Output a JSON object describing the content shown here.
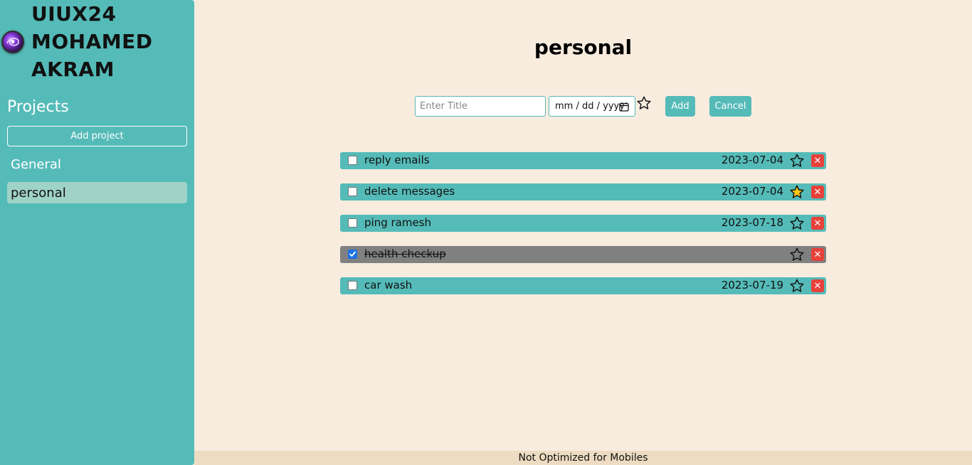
{
  "sidebar": {
    "brand": "UIUX24 MOHAMED AKRAM",
    "projects_heading": "Projects",
    "add_project_label": "Add project",
    "projects": [
      {
        "label": "General",
        "active": false
      },
      {
        "label": "personal",
        "active": true
      }
    ]
  },
  "main": {
    "title": "personal",
    "form": {
      "title_placeholder": "Enter Title",
      "date_placeholder": "mm / dd / yyyy",
      "add_label": "Add",
      "cancel_label": "Cancel"
    },
    "tasks": [
      {
        "title": "reply emails",
        "date": "2023-07-04",
        "starred": false,
        "done": false
      },
      {
        "title": "delete messages",
        "date": "2023-07-04",
        "starred": true,
        "done": false
      },
      {
        "title": "ping ramesh",
        "date": "2023-07-18",
        "starred": false,
        "done": false
      },
      {
        "title": "health checkup",
        "date": "",
        "starred": false,
        "done": true
      },
      {
        "title": "car wash",
        "date": "2023-07-19",
        "starred": false,
        "done": false
      }
    ]
  },
  "footer": {
    "text": "Not Optimized for Mobiles"
  },
  "colors": {
    "sidebar": "#55bbb8",
    "background": "#f8ecdf",
    "active_project": "#a0d3c7",
    "done_task": "#808080",
    "delete": "#e8413a",
    "star_filled": "#f5c518"
  },
  "icons": {
    "avatar": "galaxy-avatar",
    "star": "star-icon",
    "delete": "close-icon",
    "calendar": "calendar-icon",
    "check": "check-icon"
  }
}
